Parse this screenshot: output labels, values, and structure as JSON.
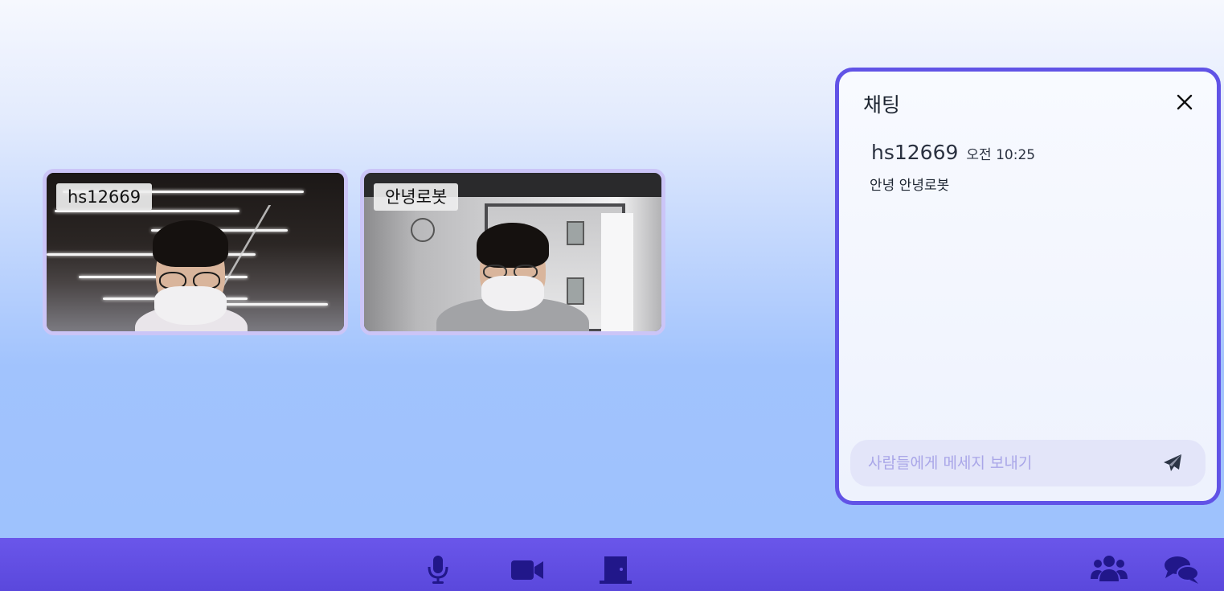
{
  "participants": [
    {
      "name": "hs12669"
    },
    {
      "name": "안녕로봇"
    }
  ],
  "chat": {
    "title": "채팅",
    "messages": [
      {
        "user": "hs12669",
        "time": "오전 10:25",
        "text": "안녕 안녕로봇"
      }
    ],
    "input_placeholder": "사람들에게 메세지 보내기"
  },
  "toolbar": {
    "icons": [
      "microphone-icon",
      "video-camera-icon",
      "exit-door-icon",
      "participants-icon",
      "chat-icon"
    ]
  },
  "colors": {
    "accent": "#6153e6",
    "toolbar_bg": "#5f4ee2",
    "icon_dark": "#21178a",
    "tile_border": "#cbc5f7"
  }
}
